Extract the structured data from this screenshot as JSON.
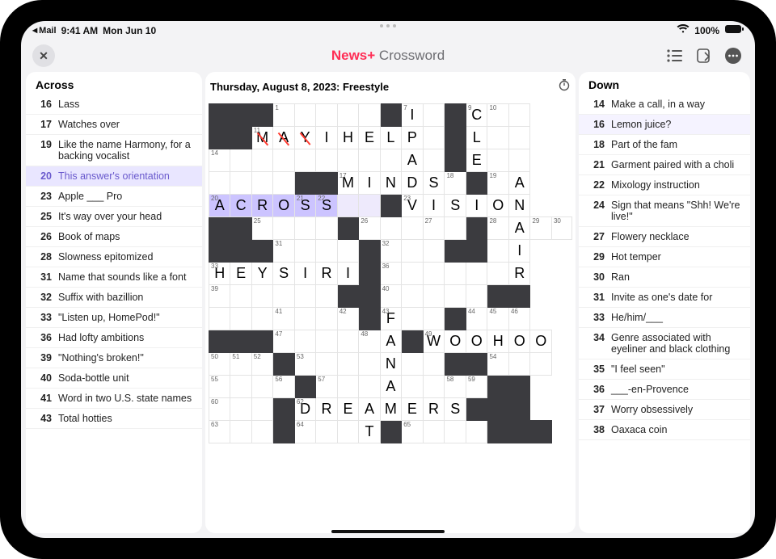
{
  "status": {
    "back_app": "Mail",
    "time": "9:41 AM",
    "date": "Mon Jun 10",
    "battery": "100%"
  },
  "nav": {
    "title_brand": "News+",
    "title_app": " Crossword"
  },
  "puzzle": {
    "title": "Thursday, August 8, 2023: Freestyle"
  },
  "across": {
    "heading": "Across",
    "clues": [
      {
        "n": "16",
        "t": "Lass"
      },
      {
        "n": "17",
        "t": "Watches over"
      },
      {
        "n": "19",
        "t": "Like the name Harmony, for a backing vocalist"
      },
      {
        "n": "20",
        "t": "This answer's orientation",
        "selected": true
      },
      {
        "n": "23",
        "t": "Apple ___ Pro"
      },
      {
        "n": "25",
        "t": "It's way over your head"
      },
      {
        "n": "26",
        "t": "Book of maps"
      },
      {
        "n": "28",
        "t": "Slowness epitomized"
      },
      {
        "n": "31",
        "t": "Name that sounds like a font"
      },
      {
        "n": "32",
        "t": "Suffix with bazillion"
      },
      {
        "n": "33",
        "t": "\"Listen up, HomePod!\""
      },
      {
        "n": "36",
        "t": "Had lofty ambitions"
      },
      {
        "n": "39",
        "t": "\"Nothing's broken!\""
      },
      {
        "n": "40",
        "t": "Soda-bottle unit"
      },
      {
        "n": "41",
        "t": "Word in two U.S. state names"
      },
      {
        "n": "43",
        "t": "Total hotties"
      }
    ]
  },
  "down": {
    "heading": "Down",
    "clues": [
      {
        "n": "14",
        "t": "Make a call, in a way"
      },
      {
        "n": "16",
        "t": "Lemon juice?",
        "hl": true
      },
      {
        "n": "18",
        "t": "Part of the fam"
      },
      {
        "n": "21",
        "t": "Garment paired with a choli"
      },
      {
        "n": "22",
        "t": "Mixology instruction"
      },
      {
        "n": "24",
        "t": "Sign that means \"Shh! We're live!\""
      },
      {
        "n": "27",
        "t": "Flowery necklace"
      },
      {
        "n": "29",
        "t": "Hot temper"
      },
      {
        "n": "30",
        "t": "Ran"
      },
      {
        "n": "31",
        "t": "Invite as one's date for"
      },
      {
        "n": "33",
        "t": "He/him/___"
      },
      {
        "n": "34",
        "t": "Genre associated with eyelin­er and black clothing"
      },
      {
        "n": "35",
        "t": "\"I feel seen\""
      },
      {
        "n": "36",
        "t": "___-en-Provence"
      },
      {
        "n": "37",
        "t": "Worry obsessively"
      },
      {
        "n": "38",
        "t": "Oaxaca coin"
      }
    ]
  },
  "grid": [
    [
      {
        "b": 1
      },
      {
        "b": 1
      },
      {
        "b": 1
      },
      {
        "n": "1"
      },
      {},
      {},
      {},
      {},
      {
        "b": 1
      },
      {
        "n": "7",
        "l": "I"
      },
      {},
      {
        "b": 1
      },
      {
        "n": "9",
        "l": "C"
      },
      {
        "n": "10"
      },
      {}
    ],
    [
      {
        "b": 1
      },
      {
        "b": 1
      },
      {
        "n": "11",
        "l": "M",
        "w": 1
      },
      {
        "l": "A",
        "w": 1
      },
      {
        "l": "Y",
        "w": 1
      },
      {
        "l": "I"
      },
      {
        "l": "H"
      },
      {
        "l": "E"
      },
      {
        "l": "L"
      },
      {
        "l": "P"
      },
      {},
      {
        "b": 1
      },
      {
        "l": "L"
      },
      {},
      {}
    ],
    [
      {
        "n": "14"
      },
      {},
      {},
      {},
      {},
      {},
      {},
      {},
      {},
      {
        "l": "A"
      },
      {},
      {
        "b": 1
      },
      {
        "l": "E"
      },
      {},
      {}
    ],
    [
      {},
      {},
      {},
      {},
      {
        "b": 1
      },
      {
        "b": 1
      },
      {
        "n": "17",
        "l": "M"
      },
      {
        "l": "I"
      },
      {
        "l": "N"
      },
      {
        "l": "D"
      },
      {
        "l": "S"
      },
      {
        "n": "18"
      },
      {
        "b": 1
      },
      {
        "n": "19"
      },
      {
        "l": "A"
      }
    ],
    [
      {
        "n": "20",
        "l": "A",
        "s": 1
      },
      {
        "l": "C",
        "s": 1
      },
      {
        "l": "R",
        "s": 1
      },
      {
        "l": "O",
        "s": 1
      },
      {
        "n": "21",
        "l": "S",
        "s": 1
      },
      {
        "n": "22",
        "l": "S",
        "s": 1
      },
      {
        "hl": 1
      },
      {
        "hl": 1
      },
      {
        "b": 1
      },
      {
        "n": "23",
        "l": "V"
      },
      {
        "l": "I"
      },
      {
        "l": "S"
      },
      {
        "l": "I"
      },
      {
        "l": "O"
      },
      {
        "l": "N"
      }
    ],
    [
      {
        "b": 1
      },
      {
        "b": 1
      },
      {
        "n": "25"
      },
      {},
      {},
      {},
      {
        "b": 1
      },
      {
        "n": "26"
      },
      {},
      {},
      {
        "n": "27"
      },
      {},
      {
        "b": 1
      },
      {
        "n": "28"
      },
      {
        "l": "A"
      },
      {
        "n": "29"
      },
      {
        "n": "30"
      }
    ],
    [
      {
        "b": 1
      },
      {
        "b": 1
      },
      {
        "b": 1
      },
      {
        "n": "31"
      },
      {},
      {},
      {},
      {
        "b": 1
      },
      {
        "n": "32"
      },
      {},
      {},
      {
        "b": 1
      },
      {
        "b": 1
      },
      {},
      {
        "l": "I"
      }
    ],
    [
      {
        "n": "33",
        "l": "H"
      },
      {
        "l": "E"
      },
      {
        "l": "Y"
      },
      {
        "l": "S"
      },
      {
        "l": "I"
      },
      {
        "l": "R"
      },
      {
        "l": "I"
      },
      {
        "b": 1
      },
      {
        "n": "36"
      },
      {},
      {},
      {},
      {},
      {},
      {
        "l": "R"
      }
    ],
    [
      {
        "n": "39"
      },
      {},
      {},
      {},
      {},
      {},
      {
        "b": 1
      },
      {
        "b": 1
      },
      {
        "n": "40"
      },
      {},
      {},
      {},
      {},
      {
        "b": 1
      },
      {
        "b": 1
      }
    ],
    [
      {},
      {},
      {},
      {
        "n": "41"
      },
      {},
      {},
      {
        "n": "42"
      },
      {
        "b": 1
      },
      {
        "n": "43",
        "l": "F"
      },
      {},
      {},
      {
        "b": 1
      },
      {
        "n": "44"
      },
      {
        "n": "45"
      },
      {
        "n": "46"
      }
    ],
    [
      {
        "b": 1
      },
      {
        "b": 1
      },
      {
        "b": 1
      },
      {
        "n": "47"
      },
      {},
      {},
      {},
      {
        "n": "48"
      },
      {
        "l": "A"
      },
      {
        "b": 1
      },
      {
        "n": "49",
        "l": "W"
      },
      {
        "l": "O"
      },
      {
        "l": "O"
      },
      {
        "l": "H"
      },
      {
        "l": "O"
      },
      {
        "l": "O"
      }
    ],
    [
      {
        "n": "50"
      },
      {
        "n": "51"
      },
      {
        "n": "52"
      },
      {
        "b": 1
      },
      {
        "n": "53"
      },
      {},
      {},
      {},
      {
        "l": "N"
      },
      {},
      {},
      {
        "b": 1
      },
      {
        "b": 1
      },
      {
        "n": "54"
      },
      {},
      {}
    ],
    [
      {
        "n": "55"
      },
      {},
      {},
      {
        "n": "56"
      },
      {
        "b": 1
      },
      {
        "n": "57"
      },
      {},
      {},
      {
        "l": "A"
      },
      {},
      {},
      {
        "n": "58"
      },
      {
        "n": "59"
      },
      {
        "b": 1
      },
      {
        "b": 1
      }
    ],
    [
      {
        "n": "60"
      },
      {},
      {},
      {
        "b": 1
      },
      {
        "n": "62",
        "l": "D"
      },
      {
        "l": "R"
      },
      {
        "l": "E"
      },
      {
        "l": "A"
      },
      {
        "l": "M"
      },
      {
        "l": "E"
      },
      {
        "l": "R"
      },
      {
        "l": "S"
      },
      {
        "b": 1
      },
      {
        "b": 1
      },
      {
        "b": 1
      }
    ],
    [
      {
        "n": "63"
      },
      {},
      {},
      {
        "b": 1
      },
      {
        "n": "64"
      },
      {},
      {},
      {
        "l": "T"
      },
      {
        "b": 1
      },
      {
        "n": "65"
      },
      {},
      {},
      {},
      {
        "b": 1
      },
      {
        "b": 1
      },
      {
        "b": 1
      }
    ]
  ]
}
